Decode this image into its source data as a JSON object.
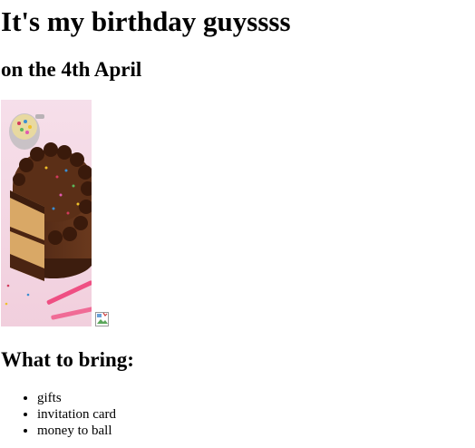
{
  "page": {
    "title": "It's my birthday guyssss",
    "subtitle": "on the 4th April"
  },
  "images": {
    "cake_photo_icon": "chocolate-cake-photo",
    "broken_image_icon": "broken-image-icon"
  },
  "bring_section": {
    "heading": "What to bring:",
    "items": [
      "gifts",
      "invitation card",
      "money to ball"
    ]
  },
  "colors": {
    "background": "#ffffff",
    "text": "#000000"
  }
}
